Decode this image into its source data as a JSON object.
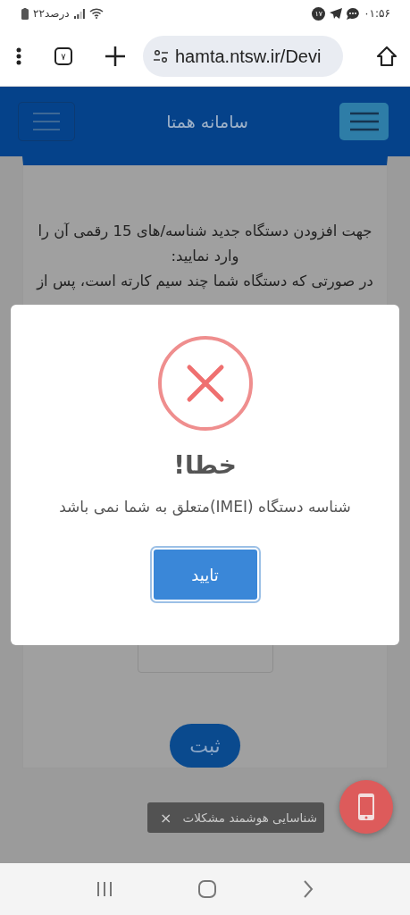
{
  "status_bar": {
    "time": "۰۱:۵۶",
    "notification_count": "۱۷",
    "battery": "۲۲درصد"
  },
  "browser": {
    "tab_count": "۷",
    "url": "hamta.ntsw.ir/Devi"
  },
  "header": {
    "title": "سامانه همتا"
  },
  "form": {
    "instruction": "جهت افزودن دستگاه جدید شناسه/های 15 رقمی آن را وارد نمایید:",
    "note": "در صورتی که دستگاه شما چند سیم کارته است، پس از",
    "submit": "ثبت"
  },
  "dialog": {
    "title": "خطا!",
    "message": "شناسه دستگاه (IMEI)متعلق به شما نمی باشد",
    "confirm": "تایید"
  },
  "toast": {
    "text": "شناسایی هوشمند مشکلات",
    "close": "×"
  }
}
